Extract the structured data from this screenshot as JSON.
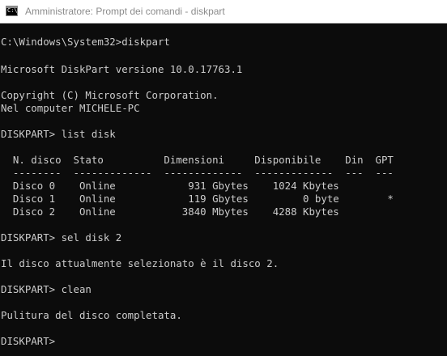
{
  "window": {
    "title": "Amministratore: Prompt dei comandi - diskpart",
    "icon": "cmd-icon",
    "icon_glyph": "C:\\_"
  },
  "colors": {
    "console_bg": "#0c0c0c",
    "console_fg": "#cccccc",
    "titlebar_bg": "#ffffff",
    "title_text": "#8c8c8c"
  },
  "console": {
    "lines": [
      "C:\\Windows\\System32>diskpart",
      "Microsoft DiskPart versione 10.0.17763.1",
      "Copyright (C) Microsoft Corporation.",
      "Nel computer MICHELE-PC",
      "DISKPART> list disk",
      "  N. disco  Stato          Dimensioni     Disponibile    Din  GPT",
      "  --------  -------------  -------------  -------------  ---  ---",
      "  Disco 0    Online            931 Gbytes    1024 Kbytes",
      "  Disco 1    Online            119 Gbytes         0 byte        *",
      "  Disco 2    Online           3840 Mbytes    4288 Kbytes",
      "DISKPART> sel disk 2",
      "Il disco attualmente selezionato è il disco 2.",
      "DISKPART> clean",
      "Pulitura del disco completata.",
      "DISKPART>"
    ]
  }
}
